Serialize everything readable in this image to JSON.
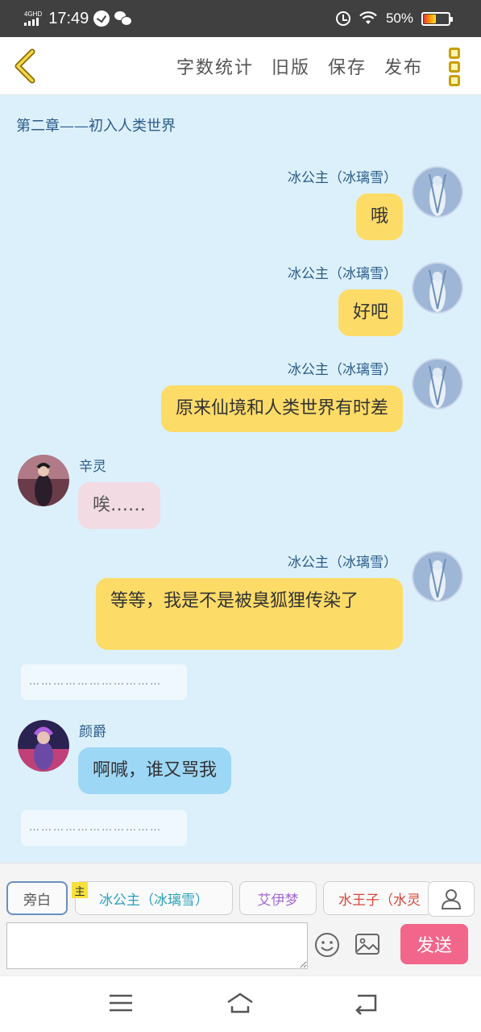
{
  "status_bar": {
    "network": "4GHD",
    "time": "17:49",
    "battery": "50%",
    "icons": [
      "signal-icon",
      "clock-app-icon",
      "wechat-icon",
      "alarm-icon",
      "wifi-icon",
      "battery-icon"
    ]
  },
  "toolbar": {
    "back_icon": "chevron-left-icon",
    "word_count": "字数统计",
    "old_version": "旧版",
    "save": "保存",
    "publish": "发布",
    "more_icon": "more-vertical-icon"
  },
  "chat": {
    "chapter_title": "第二章——初入人类世界",
    "messages": [
      {
        "side": "right",
        "speaker": "冰公主（冰璃雪）",
        "text": "哦"
      },
      {
        "side": "right",
        "speaker": "冰公主（冰璃雪）",
        "text": "好吧"
      },
      {
        "side": "right",
        "speaker": "冰公主（冰璃雪）",
        "text": "原来仙境和人类世界有时差"
      },
      {
        "side": "left",
        "speaker": "辛灵",
        "text": "唉……"
      },
      {
        "side": "right",
        "speaker": "冰公主（冰璃雪）",
        "text": "等等，我是不是被臭狐狸传染了"
      },
      {
        "side": "narration",
        "text": "……………………………"
      },
      {
        "side": "left",
        "speaker": "颜爵",
        "text": "啊喊，谁又骂我"
      },
      {
        "side": "narration",
        "text": "……………………………"
      }
    ]
  },
  "roles": {
    "narration": "旁白",
    "main_badge": "主",
    "items": [
      "冰公主（冰璃雪）",
      "艾伊梦",
      "水王子（水灵"
    ],
    "add_icon": "user-icon"
  },
  "input": {
    "value": "",
    "placeholder": "",
    "emoji_icon": "emoji-icon",
    "image_icon": "image-icon",
    "send": "发送"
  },
  "nav": {
    "icons": [
      "menu-icon",
      "home-icon",
      "back-icon"
    ]
  },
  "colors": {
    "chat_bg": "#dcf0fb",
    "bubble_self": "#fddb67",
    "bubble_xinling": "#f2dbe2",
    "bubble_yanjue": "#9dd7f6",
    "send_button": "#f2668b",
    "name_text": "#2a5c88"
  }
}
